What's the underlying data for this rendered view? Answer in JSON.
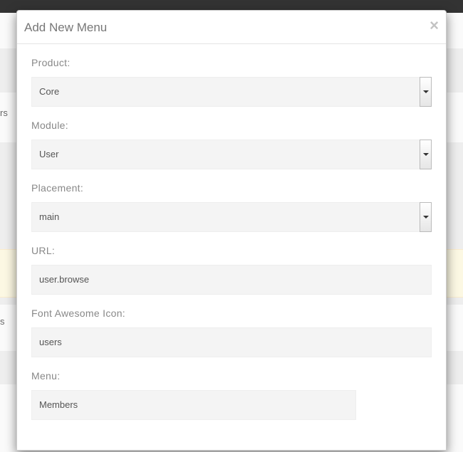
{
  "modal": {
    "title": "Add New Menu",
    "close_symbol": "×"
  },
  "form": {
    "product": {
      "label": "Product:",
      "value": "Core"
    },
    "module": {
      "label": "Module:",
      "value": "User"
    },
    "placement": {
      "label": "Placement:",
      "value": "main"
    },
    "url": {
      "label": "URL:",
      "value": "user.browse"
    },
    "icon": {
      "label": "Font Awesome Icon:",
      "value": "users"
    },
    "menu": {
      "label": "Menu:",
      "value": "Members"
    }
  },
  "background": {
    "left1": "rs",
    "left2": "s"
  }
}
